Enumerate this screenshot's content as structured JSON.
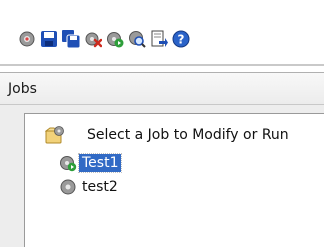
{
  "toolbar": {
    "buttons": [
      {
        "icon": "gear-icon"
      },
      {
        "icon": "save-icon"
      },
      {
        "icon": "save-all-icon"
      },
      {
        "icon": "delete-job-icon"
      },
      {
        "icon": "run-job-icon"
      },
      {
        "icon": "search-job-icon"
      },
      {
        "icon": "export-icon"
      },
      {
        "icon": "help-icon"
      }
    ]
  },
  "panel": {
    "title": "Jobs"
  },
  "tree": {
    "root_label": "Select a Job to Modify or Run",
    "items": [
      {
        "label": "Test1",
        "selected": true
      },
      {
        "label": "test2",
        "selected": false
      }
    ]
  },
  "colors": {
    "selection": "#316ac5",
    "accent_blue": "#1f4fb5",
    "accent_red": "#cc2a1e"
  }
}
